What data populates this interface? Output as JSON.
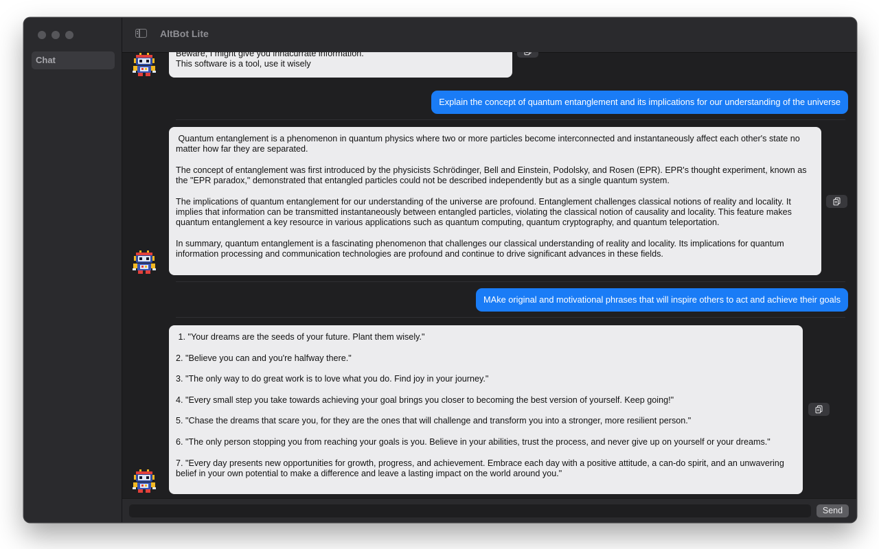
{
  "window": {
    "title": "AltBot Lite",
    "traffic_lights": [
      "close",
      "minimize",
      "zoom"
    ]
  },
  "sidebar": {
    "items": [
      {
        "label": "Chat",
        "selected": true
      }
    ]
  },
  "messages": [
    {
      "role": "bot",
      "text": "Beware, I might give you innacurrate information.\nThis software is a tool, use it wisely"
    },
    {
      "role": "user",
      "text": "Explain the concept of quantum entanglement and its implications for our understanding of the universe"
    },
    {
      "role": "bot",
      "text": " Quantum entanglement is a phenomenon in quantum physics where two or more particles become interconnected and instantaneously affect each other's state no matter how far they are separated.\n\nThe concept of entanglement was first introduced by the physicists Schrödinger, Bell and Einstein, Podolsky, and Rosen (EPR). EPR's thought experiment, known as the \"EPR paradox,\" demonstrated that entangled particles could not be described independently but as a single quantum system.\n\nThe implications of quantum entanglement for our understanding of the universe are profound. Entanglement challenges classical notions of reality and locality. It implies that information can be transmitted instantaneously between entangled particles, violating the classical notion of causality and locality. This feature makes quantum entanglement a key resource in various applications such as quantum computing, quantum cryptography, and quantum teleportation.\n\nIn summary, quantum entanglement is a fascinating phenomenon that challenges our classical understanding of reality and locality. Its implications for quantum information processing and communication technologies are profound and continue to drive significant advances in these fields."
    },
    {
      "role": "user",
      "text": "MAke original and motivational phrases that will inspire others to act and achieve their goals"
    },
    {
      "role": "bot",
      "text": " 1. \"Your dreams are the seeds of your future. Plant them wisely.\"\n\n2. \"Believe you can and you're halfway there.\"\n\n3. \"The only way to do great work is to love what you do. Find joy in your journey.\"\n\n4. \"Every small step you take towards achieving your goal brings you closer to becoming the best version of yourself. Keep going!\"\n\n5. \"Chase the dreams that scare you, for they are the ones that will challenge and transform you into a stronger, more resilient person.\"\n\n6. \"The only person stopping you from reaching your goals is you. Believe in your abilities, trust the process, and never give up on yourself or your dreams.\"\n\n7. \"Every day presents new opportunities for growth, progress, and achievement. Embrace each day with a positive attitude, a can-do spirit, and an unwavering belief in your own potential to make a difference and leave a lasting impact on the world around you.\""
    }
  ],
  "composer": {
    "value": "",
    "send_label": "Send"
  },
  "icons": {
    "copy": "copy-icon",
    "avatar": "robot-avatar-icon",
    "sidebar_toggle": "sidebar-toggle-icon"
  },
  "colors": {
    "user_bubble": "#1a7cf6",
    "bot_bubble": "#ececee",
    "background": "#1f1f21"
  }
}
